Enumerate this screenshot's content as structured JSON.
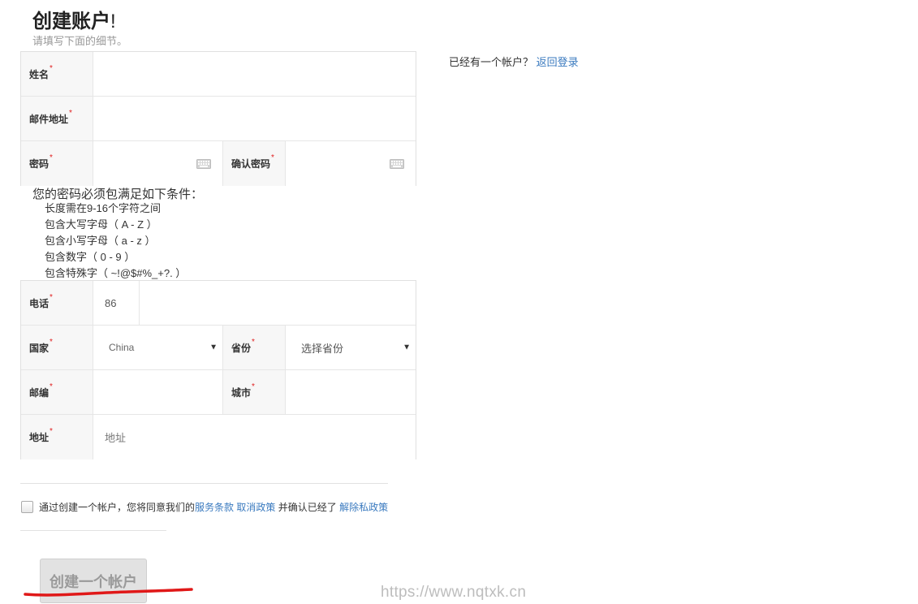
{
  "header": {
    "title": "创建账户",
    "title_suffix": "!",
    "subtitle": "请填写下面的细节。"
  },
  "login_hint": {
    "text": "已经有一个帐户？",
    "link": "返回登录"
  },
  "required_mark": "*",
  "fields": {
    "name": {
      "label": "姓名",
      "value": ""
    },
    "email": {
      "label": "邮件地址",
      "value": ""
    },
    "password": {
      "label": "密码",
      "value": ""
    },
    "confirm_password": {
      "label": "确认密码",
      "value": ""
    },
    "phone": {
      "label": "电话",
      "code": "86",
      "value": ""
    },
    "country": {
      "label": "国家",
      "selected": "China"
    },
    "province": {
      "label": "省份",
      "selected": "选择省份"
    },
    "postcode": {
      "label": "邮编",
      "value": ""
    },
    "city": {
      "label": "城市",
      "value": ""
    },
    "address": {
      "label": "地址",
      "placeholder": "地址"
    }
  },
  "password_rules": {
    "heading": "您的密码必须包满足如下条件：",
    "items": [
      "长度需在9-16个字符之间",
      "包含大写字母（ A - Z ）",
      "包含小写字母（ a - z ）",
      "包含数字（ 0 - 9 ）",
      "包含特殊字（ ~!@$#%_+?. ）"
    ]
  },
  "agreement": {
    "prefix": "通过创建一个帐户，您将同意我们的",
    "terms_link": "服务条款",
    "cancel_link": "取消政策",
    "middle": " 并确认已经了 ",
    "privacy_link": "解除私政策"
  },
  "submit": {
    "label": "创建一个帐户"
  },
  "watermark": "https://www.nqtxk.cn",
  "colors": {
    "link": "#3a7abf",
    "required": "#e02020",
    "button_bg": "#e2e2e2",
    "scribble": "#e01818"
  }
}
